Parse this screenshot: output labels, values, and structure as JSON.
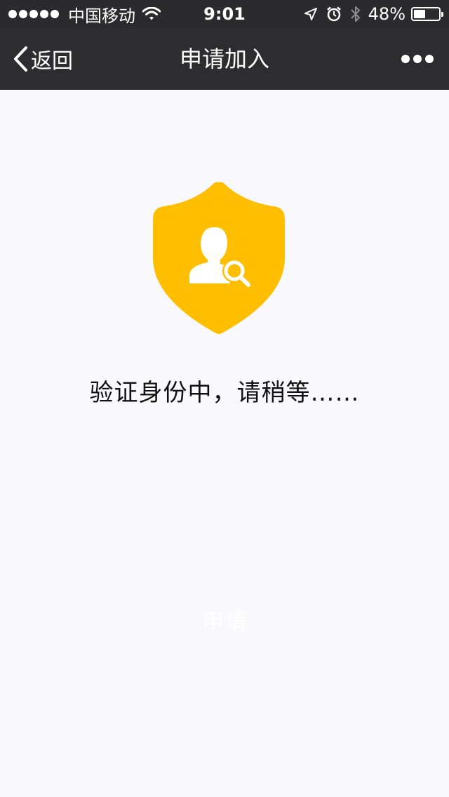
{
  "status_bar": {
    "carrier": "中国移动",
    "time": "9:01",
    "battery_percent": "48%",
    "battery_level": 0.48,
    "icons": [
      "signal-dots",
      "wifi-icon",
      "location-icon",
      "alarm-icon",
      "bluetooth-icon",
      "battery-icon"
    ]
  },
  "nav": {
    "back_label": "返回",
    "title": "申请加入",
    "more_icon": "more-dots-icon"
  },
  "main": {
    "icon": "shield-user-search-icon",
    "icon_color": "#ffbf00",
    "status_message": "验证身份中，请稍等……",
    "apply_label": "申请"
  },
  "colors": {
    "bar_background": "#2d2d2f",
    "page_background": "#f9f8fc",
    "accent": "#ffbf00"
  }
}
